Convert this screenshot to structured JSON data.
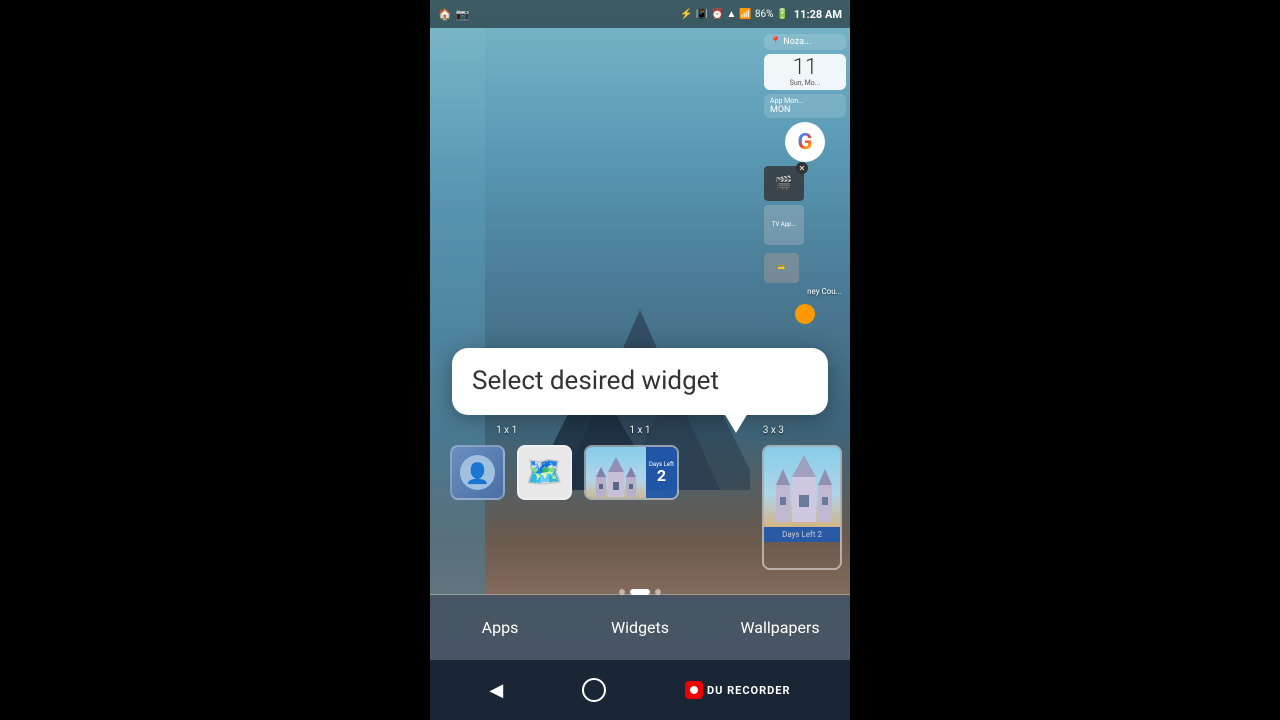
{
  "statusBar": {
    "time": "11:28 AM",
    "battery": "86%",
    "icons": [
      "notification",
      "camera",
      "bluetooth",
      "vibrate",
      "alarm",
      "wifi",
      "signal"
    ]
  },
  "tooltip": {
    "text": "Select desired widget",
    "visible": true
  },
  "rightPanel": {
    "location": "Noza...",
    "calendarDate": "11",
    "calendarDay": "Sun, Mo...",
    "appMonitor": "App Mon...",
    "mondayLabel": "MON",
    "honeyCounty": "ney Cou..."
  },
  "widgetSizes": {
    "small1": "1 x 1",
    "small2": "1 x 1",
    "large": "3 x 3"
  },
  "tabs": {
    "items": [
      {
        "label": "Apps",
        "active": false
      },
      {
        "label": "Widgets",
        "active": false
      },
      {
        "label": "Wallpapers",
        "active": false
      }
    ]
  },
  "navBar": {
    "recorderLabel": "DU RECORDER"
  },
  "disneyCastle": {
    "daysLeftLabel": "Days Left",
    "daysLeftNum": "2"
  },
  "pageIndicator": {
    "dots": 3,
    "activeDot": 1
  }
}
